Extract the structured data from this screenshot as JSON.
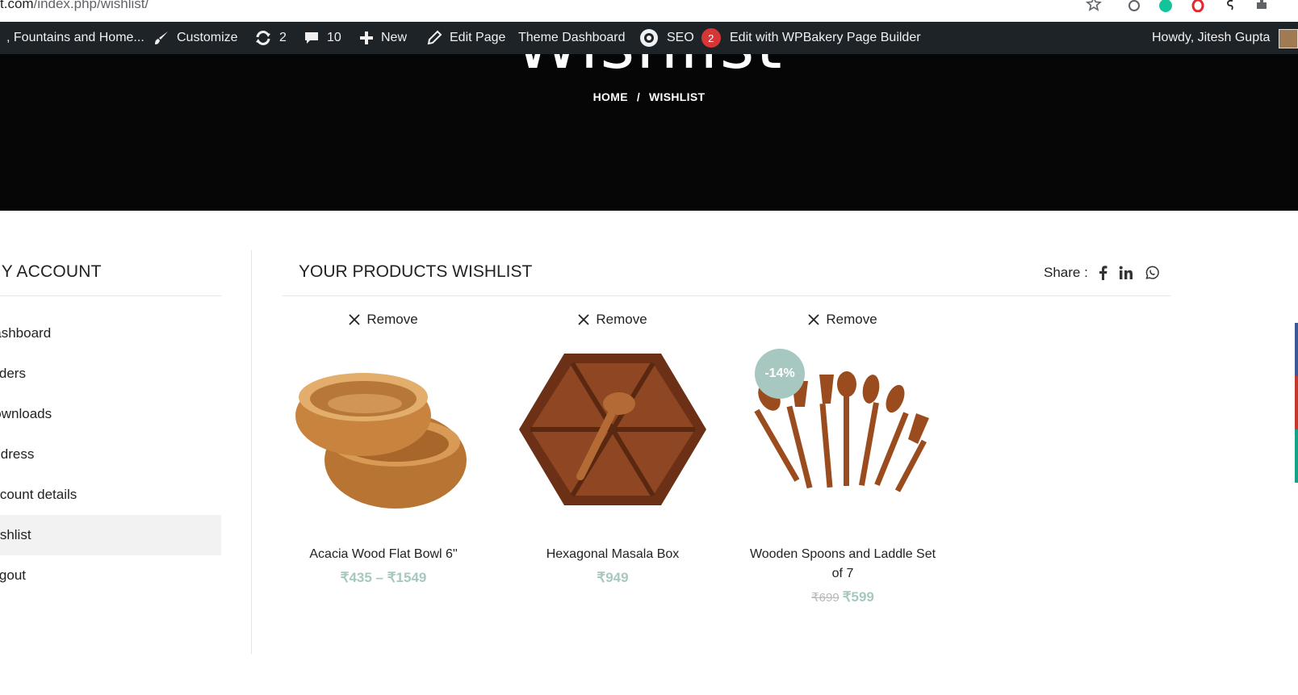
{
  "browser": {
    "url_domain": "t.com",
    "url_path": "/index.php/wishlist/"
  },
  "adminbar": {
    "site_name": ", Fountains and Home...",
    "customize": "Customize",
    "updates_count": "2",
    "comments_count": "10",
    "new_label": "New",
    "edit_page": "Edit Page",
    "theme_dashboard": "Theme Dashboard",
    "seo_label": "SEO",
    "seo_badge": "2",
    "wpbakery": "Edit with WPBakery Page Builder",
    "howdy": "Howdy, Jitesh Gupta"
  },
  "banner": {
    "page_title": "Wishlist",
    "breadcrumb_home": "HOME",
    "breadcrumb_sep": "/",
    "breadcrumb_current": "WISHLIST"
  },
  "sidebar": {
    "title": "MY ACCOUNT",
    "items": [
      {
        "label": "Dashboard"
      },
      {
        "label": "Orders"
      },
      {
        "label": "Downloads"
      },
      {
        "label": "Address"
      },
      {
        "label": "Account details"
      },
      {
        "label": "Wishlist"
      },
      {
        "label": "Logout"
      }
    ]
  },
  "wishlist": {
    "title": "YOUR PRODUCTS WISHLIST",
    "share_label": "Share :",
    "remove_label": "Remove",
    "products": [
      {
        "name": "Acacia Wood Flat Bowl 6\"",
        "price": "₹435 – ₹1549",
        "old_price": "",
        "badge": ""
      },
      {
        "name": "Hexagonal Masala Box",
        "price": "₹949",
        "old_price": "",
        "badge": ""
      },
      {
        "name": "Wooden Spoons and Laddle Set of 7",
        "price": "₹599",
        "old_price": "₹699",
        "badge": "-14%"
      }
    ]
  },
  "colors": {
    "accent": "#a7c8c0",
    "adminbar_bg": "#1d2327",
    "banner_bg": "#060606"
  }
}
